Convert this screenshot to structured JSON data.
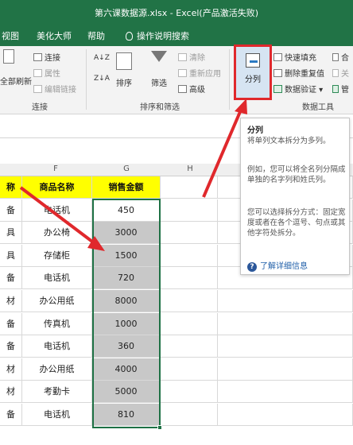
{
  "window": {
    "title": "第六课数据源.xlsx  -  Excel(产品激活失败)"
  },
  "menu": {
    "view": "视图",
    "beautify": "美化大师",
    "help": "帮助",
    "tell_me": "操作说明搜索"
  },
  "ribbon": {
    "refresh_all": "全部刷新",
    "connections": "连接",
    "properties": "属性",
    "edit_links": "编辑链接",
    "group_connections": "连接",
    "sort_az": "A↓Z",
    "sort_za": "Z↓A",
    "sort": "排序",
    "filter": "筛选",
    "clear": "清除",
    "reapply": "重新应用",
    "advanced": "高级",
    "group_sort_filter": "排序和筛选",
    "text_to_columns": "分列",
    "flash_fill": "快速填充",
    "remove_duplicates": "删除重复值",
    "data_validation": "数据验证",
    "consolidate": "合",
    "relationships": "关",
    "manage": "管",
    "group_data_tools": "数据工具"
  },
  "tooltip": {
    "title": "分列",
    "p1": "将单列文本拆分为多列。",
    "p2": "例如，您可以将全名列分隔成单独的名字列和姓氏列。",
    "p3": "您可以选择拆分方式：固定宽度或者在各个逗号、句点或其他字符处拆分。",
    "link": "了解详细信息"
  },
  "columns": {
    "f": "F",
    "g": "G",
    "h": "H"
  },
  "table": {
    "headers": {
      "e": "称",
      "f": "商品名称",
      "g": "销售金额"
    },
    "rows": [
      {
        "e": "备",
        "f": "电话机",
        "g": "450"
      },
      {
        "e": "具",
        "f": "办公椅",
        "g": "3000"
      },
      {
        "e": "具",
        "f": "存储柜",
        "g": "1500"
      },
      {
        "e": "备",
        "f": "电话机",
        "g": "720"
      },
      {
        "e": "材",
        "f": "办公用纸",
        "g": "8000"
      },
      {
        "e": "备",
        "f": "传真机",
        "g": "1000"
      },
      {
        "e": "备",
        "f": "电话机",
        "g": "360"
      },
      {
        "e": "材",
        "f": "办公用纸",
        "g": "4000"
      },
      {
        "e": "材",
        "f": "考勤卡",
        "g": "5000"
      },
      {
        "e": "备",
        "f": "电话机",
        "g": "810"
      }
    ]
  },
  "colors": {
    "excel_green": "#217346",
    "header_yellow": "#ffff00",
    "annotation_red": "#e0282c"
  }
}
